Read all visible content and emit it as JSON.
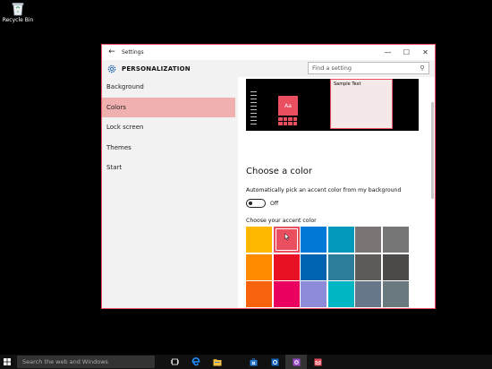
{
  "desktop": {
    "recycle_bin_label": "Recycle Bin"
  },
  "window": {
    "title": "Settings",
    "controls": {
      "minimize": "—",
      "maximize": "☐",
      "close": "✕"
    },
    "back_glyph": "←"
  },
  "header": {
    "section_title": "PERSONALIZATION",
    "search_placeholder": "Find a setting"
  },
  "sidebar": {
    "items": [
      {
        "label": "Background",
        "active": false
      },
      {
        "label": "Colors",
        "active": true
      },
      {
        "label": "Lock screen",
        "active": false
      },
      {
        "label": "Themes",
        "active": false
      },
      {
        "label": "Start",
        "active": false
      }
    ]
  },
  "preview": {
    "tile_label": "Aa",
    "sample_text": "Sample Text",
    "accent_color": "#e94f5e"
  },
  "colors": {
    "heading": "Choose a color",
    "auto_pick_label": "Automatically pick an accent color from my background",
    "auto_pick_state": "Off",
    "accent_label": "Choose your accent color",
    "swatches": [
      "#ffb900",
      "#e94f5e",
      "#0078d7",
      "#0099bc",
      "#7a7574",
      "#767676",
      "#ff8c00",
      "#e81123",
      "#0063b1",
      "#2d7d9a",
      "#5d5a58",
      "#4c4a48",
      "#f7630c",
      "#ea005e",
      "#8e8cd8",
      "#00b7c3",
      "#68768a",
      "#69797e"
    ],
    "selected_index": 1
  },
  "taskbar": {
    "search_placeholder": "Search the web and Windows",
    "icons": [
      {
        "name": "task-view-icon",
        "color": "#ffffff"
      },
      {
        "name": "edge-icon",
        "color": "#1e90ff"
      },
      {
        "name": "file-explorer-icon",
        "color": "#f5c242"
      },
      {
        "name": "store-icon",
        "color": "#2b7bd6"
      },
      {
        "name": "outlook-icon",
        "color": "#1565c0"
      },
      {
        "name": "settings-app-icon",
        "color": "#9c4dcc"
      },
      {
        "name": "mail-app-icon",
        "color": "#e94f5e"
      }
    ]
  }
}
